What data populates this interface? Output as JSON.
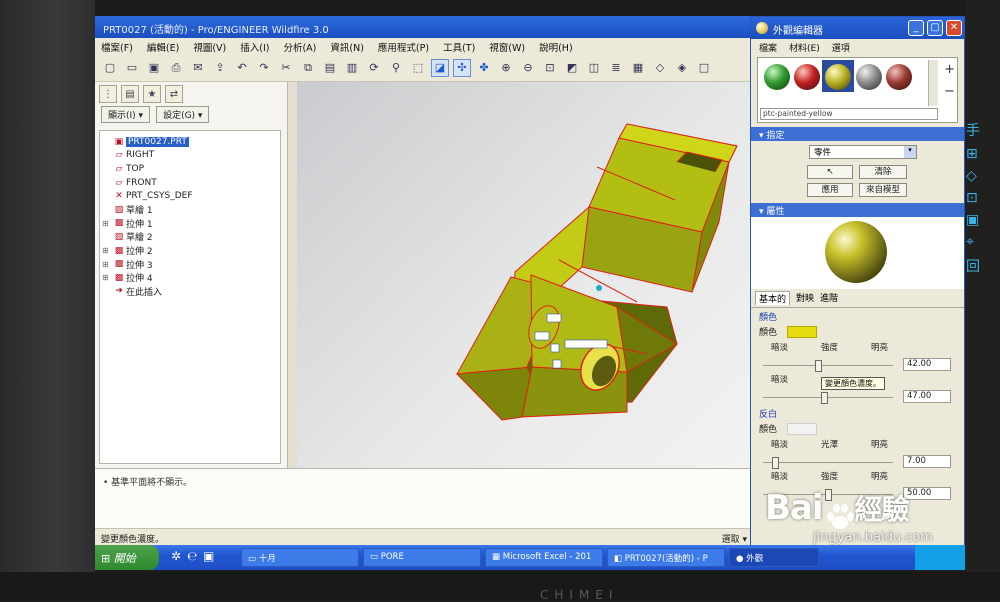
{
  "main_window": {
    "title": "PRT0027 (活動的) - Pro/ENGINEER Wildfire 3.0",
    "menu": [
      "檔案(F)",
      "編輯(E)",
      "視圖(V)",
      "插入(I)",
      "分析(A)",
      "資訊(N)",
      "應用程式(P)",
      "工具(T)",
      "視窗(W)",
      "說明(H)"
    ],
    "panel_buttons": {
      "show": "顯示(I) ▾",
      "settings": "設定(G) ▾"
    },
    "tree": [
      {
        "label": "PRT0027.PRT",
        "icon": "part-icon",
        "expandable": false
      },
      {
        "label": "RIGHT",
        "icon": "datum-plane-icon",
        "expandable": false
      },
      {
        "label": "TOP",
        "icon": "datum-plane-icon",
        "expandable": false
      },
      {
        "label": "FRONT",
        "icon": "datum-plane-icon",
        "expandable": false
      },
      {
        "label": "PRT_CSYS_DEF",
        "icon": "csys-icon",
        "expandable": false
      },
      {
        "label": "草繪 1",
        "icon": "sketch-icon",
        "expandable": false
      },
      {
        "label": "拉伸 1",
        "icon": "extrude-icon",
        "expandable": true
      },
      {
        "label": "草繪 2",
        "icon": "sketch-icon",
        "expandable": false
      },
      {
        "label": "拉伸 2",
        "icon": "extrude-icon",
        "expandable": true
      },
      {
        "label": "拉伸 3",
        "icon": "extrude-icon",
        "expandable": true
      },
      {
        "label": "拉伸 4",
        "icon": "extrude-icon",
        "expandable": true
      },
      {
        "label": "在此插入",
        "icon": "insert-here-icon",
        "expandable": false
      }
    ],
    "message": "• 基準平面將不顯示。",
    "status_left": "變更顏色濃度。",
    "status_right": "選取 ▾"
  },
  "appearance_editor": {
    "title": "外觀編輯器",
    "menu": [
      "檔案",
      "材料(E)",
      "選項"
    ],
    "palette_name": "ptc-painted-yellow",
    "swatches": [
      {
        "name": "green-sphere-swatch",
        "color": "#2f9a2f"
      },
      {
        "name": "red-sphere-swatch",
        "color": "#c02020"
      },
      {
        "name": "yellow-sphere-swatch",
        "color": "#b8b022"
      },
      {
        "name": "gray-sphere-swatch",
        "color": "#8a8a8a"
      },
      {
        "name": "dark-red-sphere-swatch",
        "color": "#9a3a34"
      }
    ],
    "assign_header": "指定",
    "assign_dropdown": "零件",
    "btn_clear": "清除",
    "btn_apply": "應用",
    "btn_from_model": "來自模型",
    "properties_header": "屬性",
    "tabs": [
      "基本的",
      "對映",
      "進階"
    ],
    "color_group": "顏色",
    "color_label": "顏色",
    "color_value": "#e6dc10",
    "dim_label": "暗淡",
    "intensity_label": "強度",
    "bright_label": "明亮",
    "intensity_value": "42.00",
    "intensity_level": 0.42,
    "ambient_value": "47.00",
    "ambient_level": 0.47,
    "tooltip": "變更顏色濃度。",
    "highlight_group": "反白",
    "highlight_color_label": "顏色",
    "gloss_label": "光澤",
    "gloss_value": "7.00",
    "gloss_level": 0.07,
    "hl_intensity_value": "50.00",
    "hl_intensity_level": 0.5
  },
  "taskbar": {
    "start": "開始",
    "items": [
      "十月",
      "PORE",
      "Microsoft Excel - 201",
      "PRT0027(活動的) - P",
      "外觀"
    ]
  },
  "watermark": {
    "logo_left": "Bai",
    "logo_right": "經驗",
    "url": "jingyan.baidu.com"
  },
  "monitor_brand": "CHIMEI"
}
